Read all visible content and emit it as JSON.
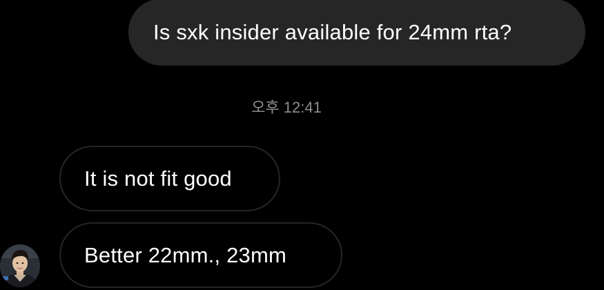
{
  "conversation": {
    "messages": [
      {
        "direction": "sent",
        "text": "Is sxk insider available for 24mm rta?"
      },
      {
        "direction": "received",
        "text": "It is not fit good"
      },
      {
        "direction": "received",
        "text": "Better 22mm., 23mm"
      }
    ],
    "timestamp": "오후 12:41"
  },
  "contact": {
    "avatar_icon": "user-avatar-photo"
  },
  "colors": {
    "background": "#000000",
    "sent_bubble": "#262626",
    "received_bubble_border": "#262626",
    "message_text": "#ffffff",
    "timestamp_text": "#8e8e8e"
  }
}
